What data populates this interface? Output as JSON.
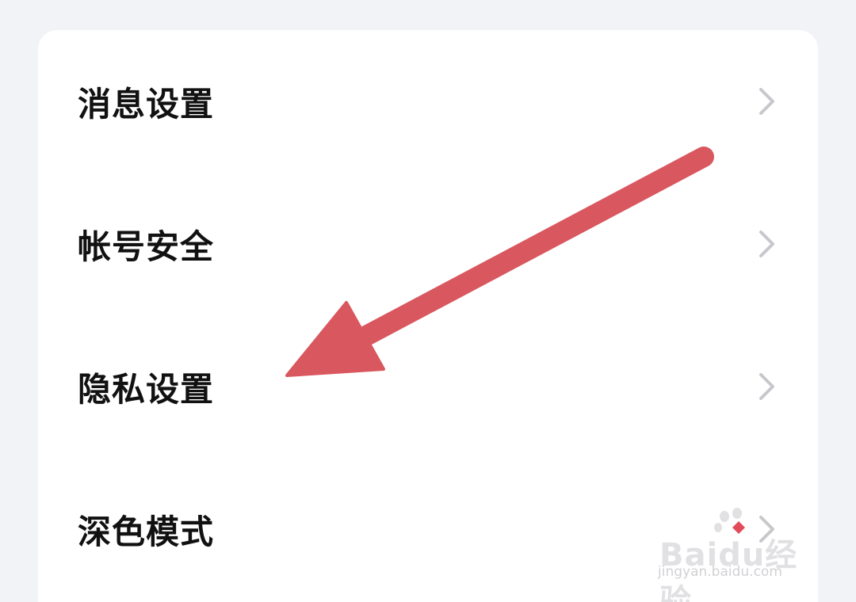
{
  "settings": {
    "items": [
      {
        "label": "消息设置",
        "icon": "chevron-right-icon"
      },
      {
        "label": "帐号安全",
        "icon": "chevron-right-icon"
      },
      {
        "label": "隐私设置",
        "icon": "chevron-right-icon"
      },
      {
        "label": "深色模式",
        "icon": "chevron-right-icon"
      }
    ]
  },
  "annotation": {
    "arrow_color": "#d9575f",
    "arrow_icon": "red-arrow-annotation"
  },
  "watermark": {
    "logo_text": "Baidu经验",
    "url": "jingyan.baidu.com"
  },
  "colors": {
    "background": "#f2f3f7",
    "card": "#ffffff",
    "text": "#111111",
    "chevron": "#c8c8cc"
  }
}
